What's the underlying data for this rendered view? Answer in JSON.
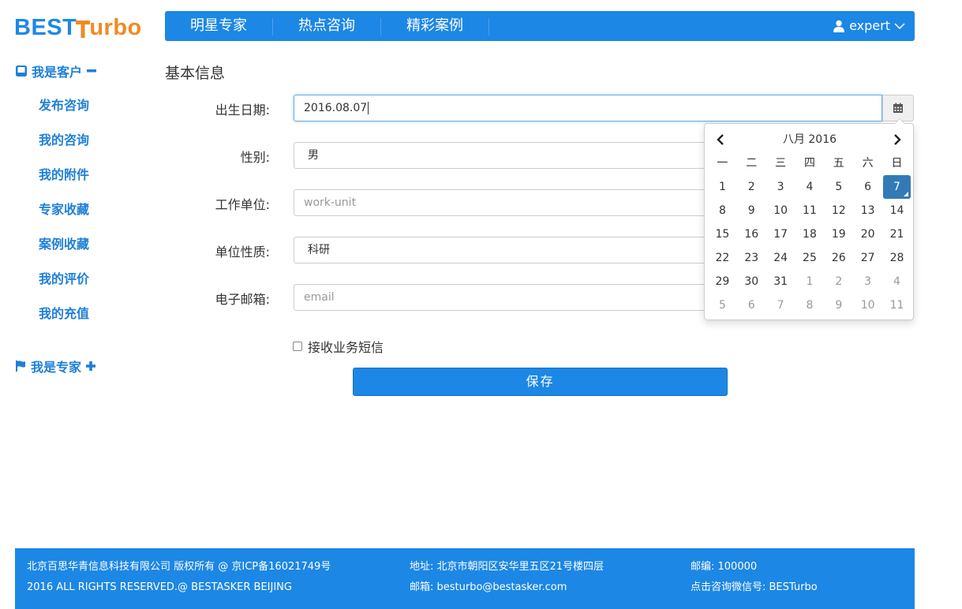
{
  "logo": {
    "part1": "BEST",
    "part2": "urbo"
  },
  "nav": {
    "items": [
      "明星专家",
      "热点咨询",
      "精彩案例"
    ],
    "user": "expert"
  },
  "sidebar": {
    "customer_group": "我是客户",
    "customer_items": [
      "发布咨询",
      "我的咨询",
      "我的附件",
      "专家收藏",
      "案例收藏",
      "我的评价",
      "我的充值"
    ],
    "expert_group": "我是专家"
  },
  "form": {
    "title": "基本信息",
    "birthday_label": "出生日期:",
    "birthday_value": "2016.08.07",
    "gender_label": "性别:",
    "gender_value": "男",
    "work_label": "工作单位:",
    "work_placeholder": "work-unit",
    "nature_label": "单位性质:",
    "nature_value": "科研",
    "email_label": "电子邮箱:",
    "email_placeholder": "email",
    "sms_label": "接收业务短信",
    "sms_checked": false,
    "save_label": "保存"
  },
  "datepicker": {
    "title": "八月 2016",
    "weekdays": [
      "一",
      "二",
      "三",
      "四",
      "五",
      "六",
      "日"
    ],
    "selected_day": "7",
    "weeks": [
      [
        "1",
        "2",
        "3",
        "4",
        "5",
        "6",
        "7"
      ],
      [
        "8",
        "9",
        "10",
        "11",
        "12",
        "13",
        "14"
      ],
      [
        "15",
        "16",
        "17",
        "18",
        "19",
        "20",
        "21"
      ],
      [
        "22",
        "23",
        "24",
        "25",
        "26",
        "27",
        "28"
      ],
      [
        "29",
        "30",
        "31",
        "1",
        "2",
        "3",
        "4"
      ],
      [
        "5",
        "6",
        "7",
        "8",
        "9",
        "10",
        "11"
      ]
    ]
  },
  "footer": {
    "company": "北京百思华青信息科技有限公司 版权所有 @ 京ICP备16021749号",
    "rights": "2016 ALL RIGHTS RESERVED.@ BESTASKER BEIJING",
    "address": "地址: 北京市朝阳区安华里五区21号楼四层",
    "email": "邮箱: besturbo@bestasker.com",
    "postcode": "邮编: 100000",
    "wechat": "点击咨询微信号: BESTurbo"
  },
  "colors": {
    "brand_blue": "#1c87e5",
    "brand_orange": "#f08a24",
    "link_blue": "#1e7fd8",
    "selected_day": "#337ab7"
  }
}
